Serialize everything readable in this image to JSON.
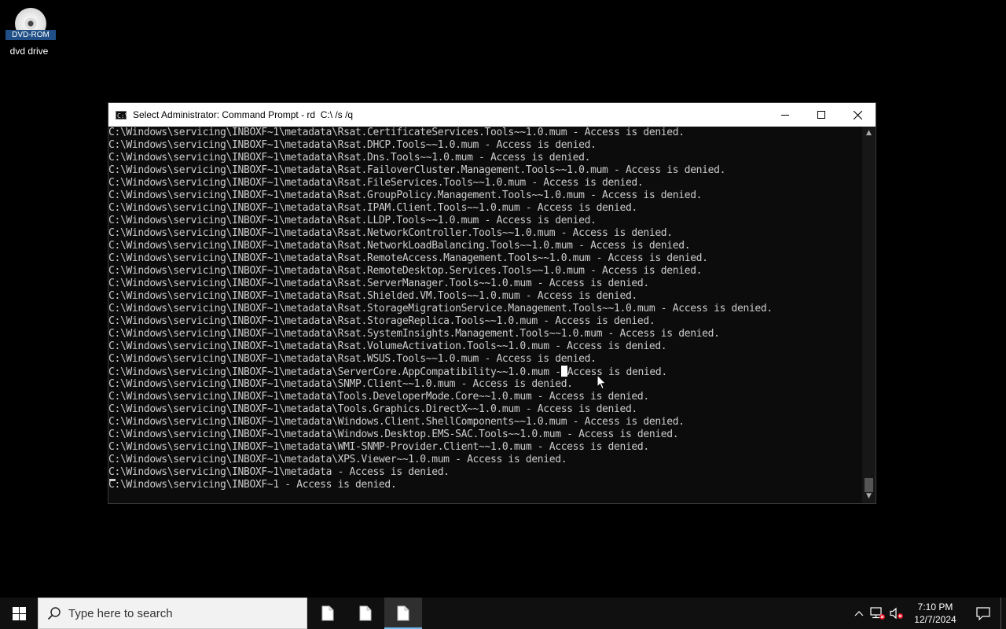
{
  "desktop": {
    "icons": [
      {
        "label": "dvd drive",
        "drive_badge": "DVD-ROM"
      }
    ]
  },
  "window": {
    "title": "Select Administrator: Command Prompt - rd  C:\\ /s /q",
    "icon_glyph": "C:\\",
    "controls": {
      "minimize": "minimize-icon",
      "maximize": "maximize-icon",
      "close": "close-icon"
    }
  },
  "console": {
    "lines": [
      "C:\\Windows\\servicing\\INBOXF~1\\metadata\\Rsat.CertificateServices.Tools~~1.0.mum - Access is denied.",
      "C:\\Windows\\servicing\\INBOXF~1\\metadata\\Rsat.DHCP.Tools~~1.0.mum - Access is denied.",
      "C:\\Windows\\servicing\\INBOXF~1\\metadata\\Rsat.Dns.Tools~~1.0.mum - Access is denied.",
      "C:\\Windows\\servicing\\INBOXF~1\\metadata\\Rsat.FailoverCluster.Management.Tools~~1.0.mum - Access is denied.",
      "C:\\Windows\\servicing\\INBOXF~1\\metadata\\Rsat.FileServices.Tools~~1.0.mum - Access is denied.",
      "C:\\Windows\\servicing\\INBOXF~1\\metadata\\Rsat.GroupPolicy.Management.Tools~~1.0.mum - Access is denied.",
      "C:\\Windows\\servicing\\INBOXF~1\\metadata\\Rsat.IPAM.Client.Tools~~1.0.mum - Access is denied.",
      "C:\\Windows\\servicing\\INBOXF~1\\metadata\\Rsat.LLDP.Tools~~1.0.mum - Access is denied.",
      "C:\\Windows\\servicing\\INBOXF~1\\metadata\\Rsat.NetworkController.Tools~~1.0.mum - Access is denied.",
      "C:\\Windows\\servicing\\INBOXF~1\\metadata\\Rsat.NetworkLoadBalancing.Tools~~1.0.mum - Access is denied.",
      "C:\\Windows\\servicing\\INBOXF~1\\metadata\\Rsat.RemoteAccess.Management.Tools~~1.0.mum - Access is denied.",
      "C:\\Windows\\servicing\\INBOXF~1\\metadata\\Rsat.RemoteDesktop.Services.Tools~~1.0.mum - Access is denied.",
      "C:\\Windows\\servicing\\INBOXF~1\\metadata\\Rsat.ServerManager.Tools~~1.0.mum - Access is denied.",
      "C:\\Windows\\servicing\\INBOXF~1\\metadata\\Rsat.Shielded.VM.Tools~~1.0.mum - Access is denied.",
      "C:\\Windows\\servicing\\INBOXF~1\\metadata\\Rsat.StorageMigrationService.Management.Tools~~1.0.mum - Access is denied.",
      "C:\\Windows\\servicing\\INBOXF~1\\metadata\\Rsat.StorageReplica.Tools~~1.0.mum - Access is denied.",
      "C:\\Windows\\servicing\\INBOXF~1\\metadata\\Rsat.SystemInsights.Management.Tools~~1.0.mum - Access is denied.",
      "C:\\Windows\\servicing\\INBOXF~1\\metadata\\Rsat.VolumeActivation.Tools~~1.0.mum - Access is denied.",
      "C:\\Windows\\servicing\\INBOXF~1\\metadata\\Rsat.WSUS.Tools~~1.0.mum - Access is denied.",
      "C:\\Windows\\servicing\\INBOXF~1\\metadata\\ServerCore.AppCompatibility~~1.0.mum - Access is denied.",
      "C:\\Windows\\servicing\\INBOXF~1\\metadata\\SNMP.Client~~1.0.mum - Access is denied.",
      "C:\\Windows\\servicing\\INBOXF~1\\metadata\\Tools.DeveloperMode.Core~~1.0.mum - Access is denied.",
      "C:\\Windows\\servicing\\INBOXF~1\\metadata\\Tools.Graphics.DirectX~~1.0.mum - Access is denied.",
      "C:\\Windows\\servicing\\INBOXF~1\\metadata\\Windows.Client.ShellComponents~~1.0.mum - Access is denied.",
      "C:\\Windows\\servicing\\INBOXF~1\\metadata\\Windows.Desktop.EMS-SAC.Tools~~1.0.mum - Access is denied.",
      "C:\\Windows\\servicing\\INBOXF~1\\metadata\\WMI-SNMP-Provider.Client~~1.0.mum - Access is denied.",
      "C:\\Windows\\servicing\\INBOXF~1\\metadata\\XPS.Viewer~~1.0.mum - Access is denied.",
      "C:\\Windows\\servicing\\INBOXF~1\\metadata - Access is denied.",
      "C:\\Windows\\servicing\\INBOXF~1 - Access is denied."
    ],
    "selection": {
      "line": 19,
      "col": 77
    }
  },
  "taskbar": {
    "search_placeholder": "Type here to search",
    "apps": [
      {
        "name": "file-app-icon",
        "state": "idle"
      },
      {
        "name": "file-app-icon",
        "state": "idle"
      },
      {
        "name": "file-app-icon",
        "state": "active"
      }
    ],
    "clock": {
      "time": "7:10 PM",
      "date": "12/7/2024"
    },
    "accent": "#76b9ed"
  }
}
